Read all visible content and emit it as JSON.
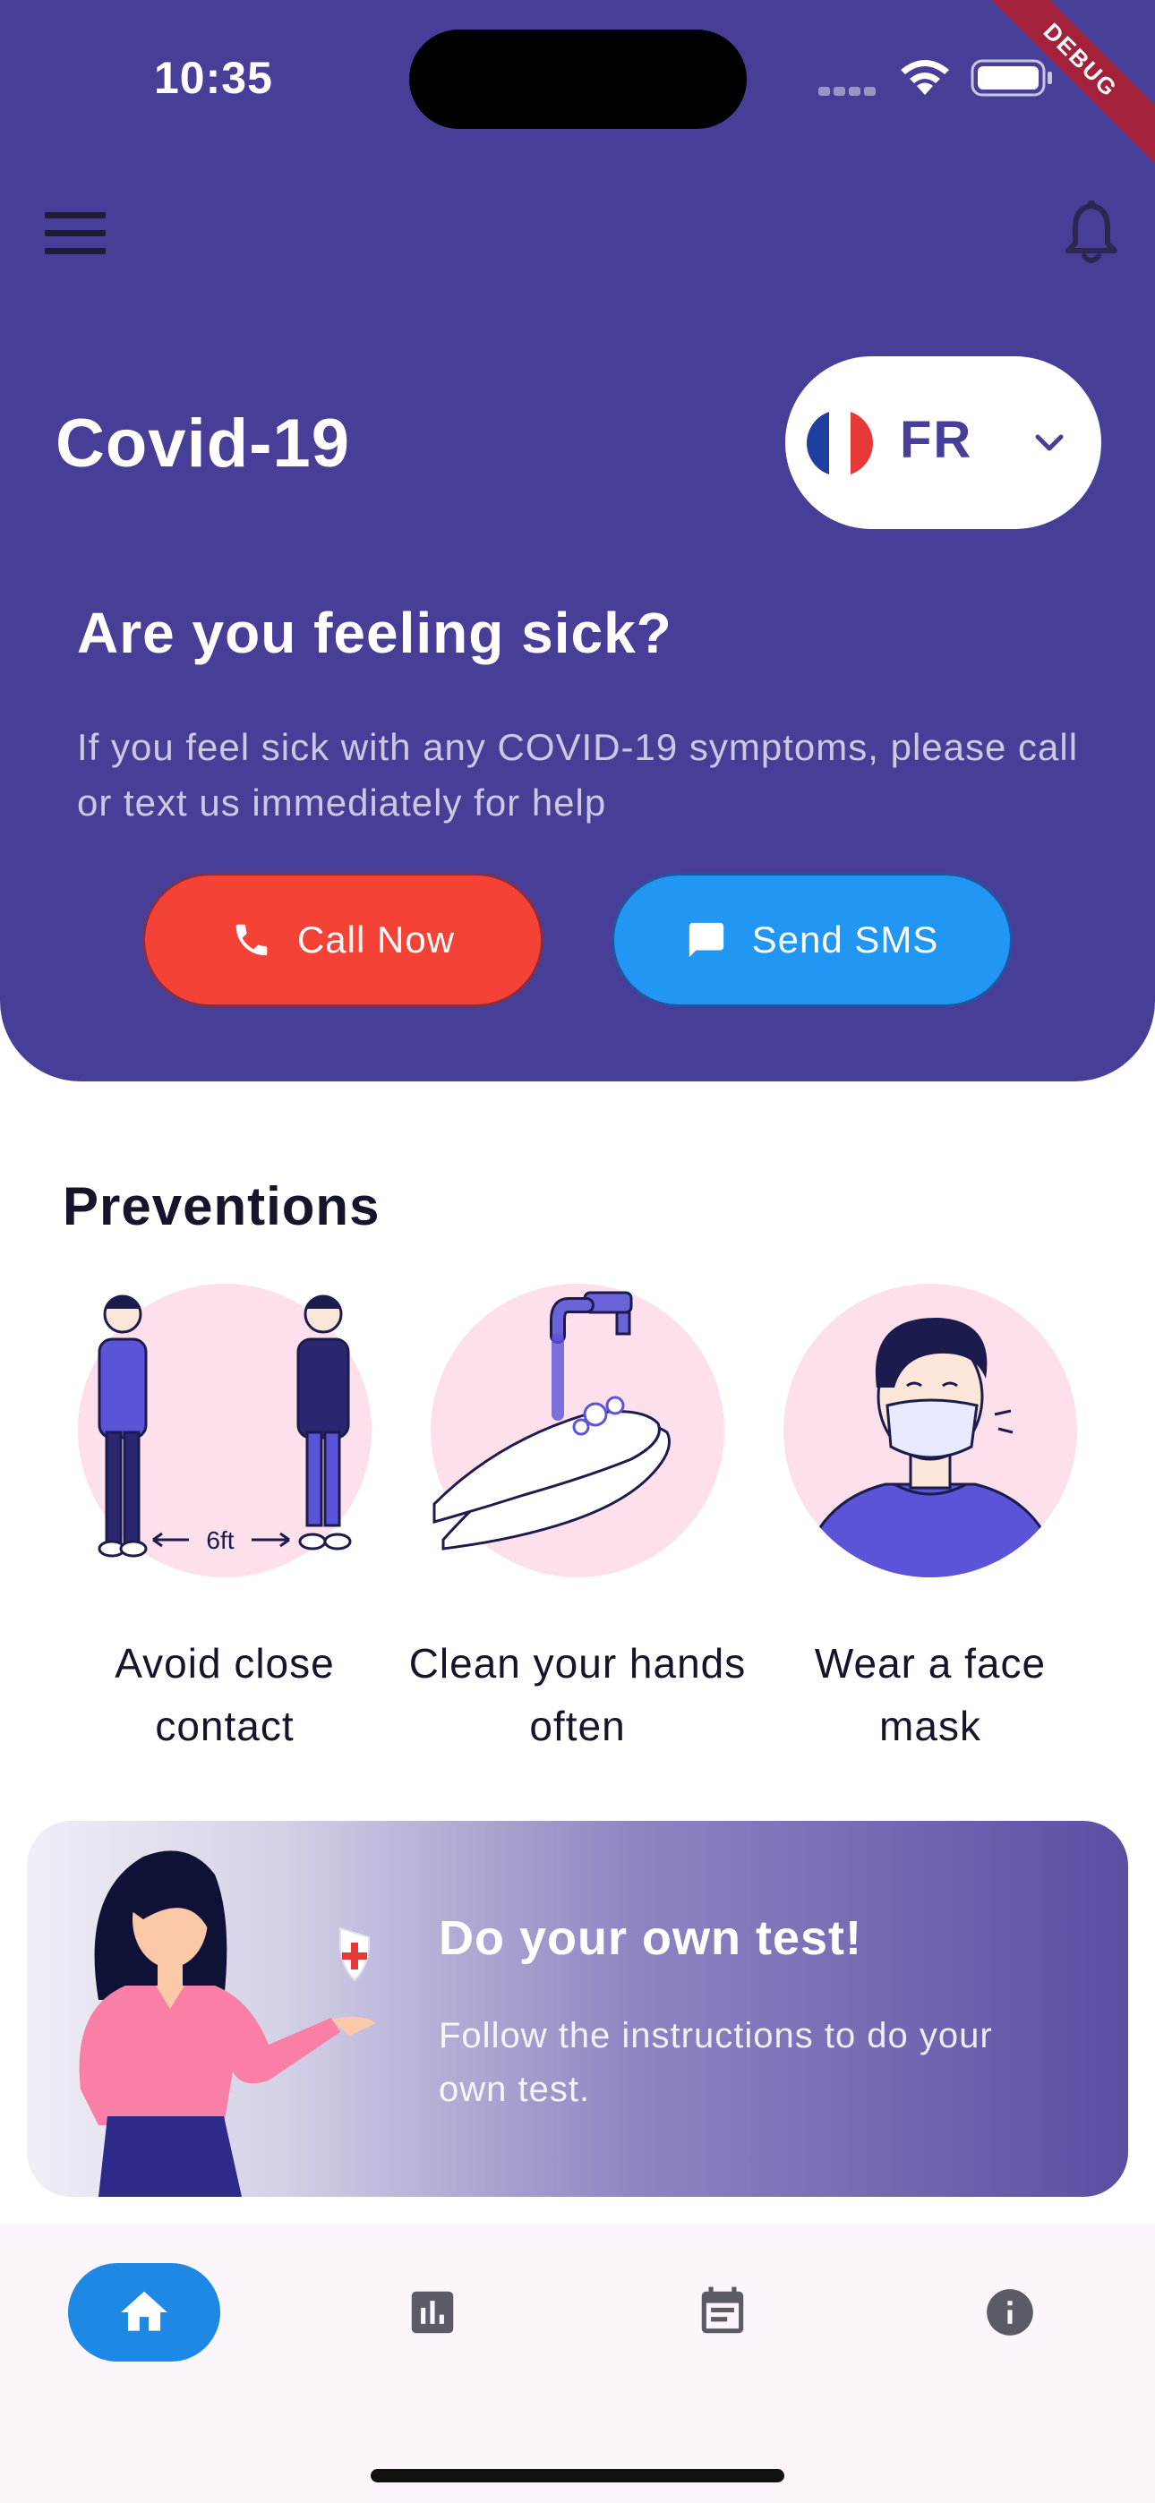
{
  "status_bar": {
    "time": "10:35",
    "wifi_icon": "wifi-icon",
    "battery_icon": "battery-icon",
    "debug_label": "DEBUG"
  },
  "header": {
    "menu_icon": "menu-icon",
    "notification_icon": "bell-icon",
    "title": "Covid-19",
    "language": {
      "flag_icon": "france-flag-icon",
      "code": "FR",
      "dropdown_icon": "chevron-down-icon"
    }
  },
  "hero": {
    "heading": "Are you feeling sick?",
    "text": "If you feel sick with any COVID-19 symptoms, please call or text us immediately for help",
    "call_button": "Call Now",
    "sms_button": "Send SMS"
  },
  "preventions": {
    "title": "Preventions",
    "items": [
      {
        "label": "Avoid close contact",
        "illustration": "social-distance-illustration",
        "caption": "6ft"
      },
      {
        "label": "Clean your hands often",
        "illustration": "hand-washing-illustration"
      },
      {
        "label": "Wear a face mask",
        "illustration": "face-mask-illustration"
      }
    ]
  },
  "test_banner": {
    "title": "Do your own test!",
    "text": "Follow the instructions to do your own test."
  },
  "bottom_nav": {
    "items": [
      {
        "icon": "home-icon",
        "active": true
      },
      {
        "icon": "bar-chart-icon",
        "active": false
      },
      {
        "icon": "calendar-icon",
        "active": false
      },
      {
        "icon": "info-icon",
        "active": false
      }
    ]
  },
  "colors": {
    "primary": "#473f97",
    "call": "#f44336",
    "sms": "#2196f3",
    "nav_active": "#1e88e5",
    "debug": "#a3213b"
  }
}
